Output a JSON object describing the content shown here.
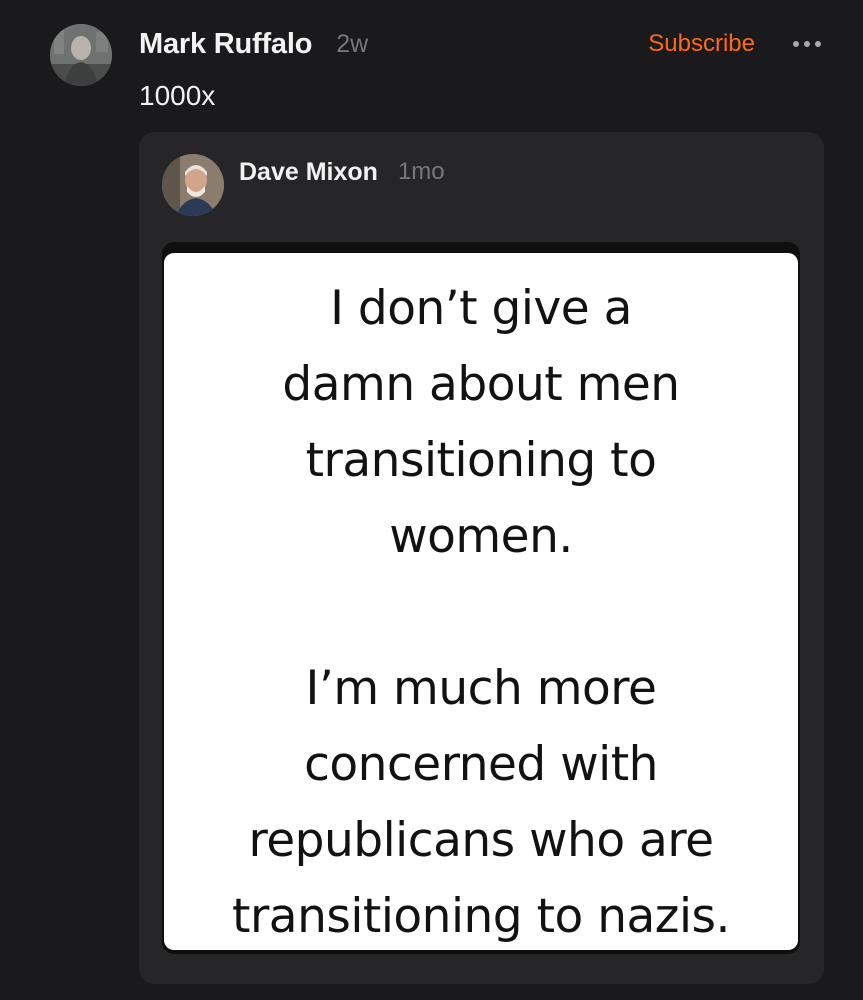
{
  "post": {
    "author": "Mark Ruffalo",
    "time": "2w",
    "subscribe_label": "Subscribe",
    "more_icon": "more-horizontal-icon",
    "text": "1000x"
  },
  "quoted": {
    "author": "Dave Mixon",
    "time": "1mo",
    "image_text": {
      "paragraph1": "I don’t give a\ndamn about men\ntransitioning to\nwomen.",
      "paragraph2": "I’m much more\nconcerned with\nrepublicans who are\ntransitioning to nazis."
    }
  },
  "colors": {
    "background": "#1a1a1c",
    "card": "#262628",
    "accent": "#ff6719",
    "muted": "#76767b"
  }
}
